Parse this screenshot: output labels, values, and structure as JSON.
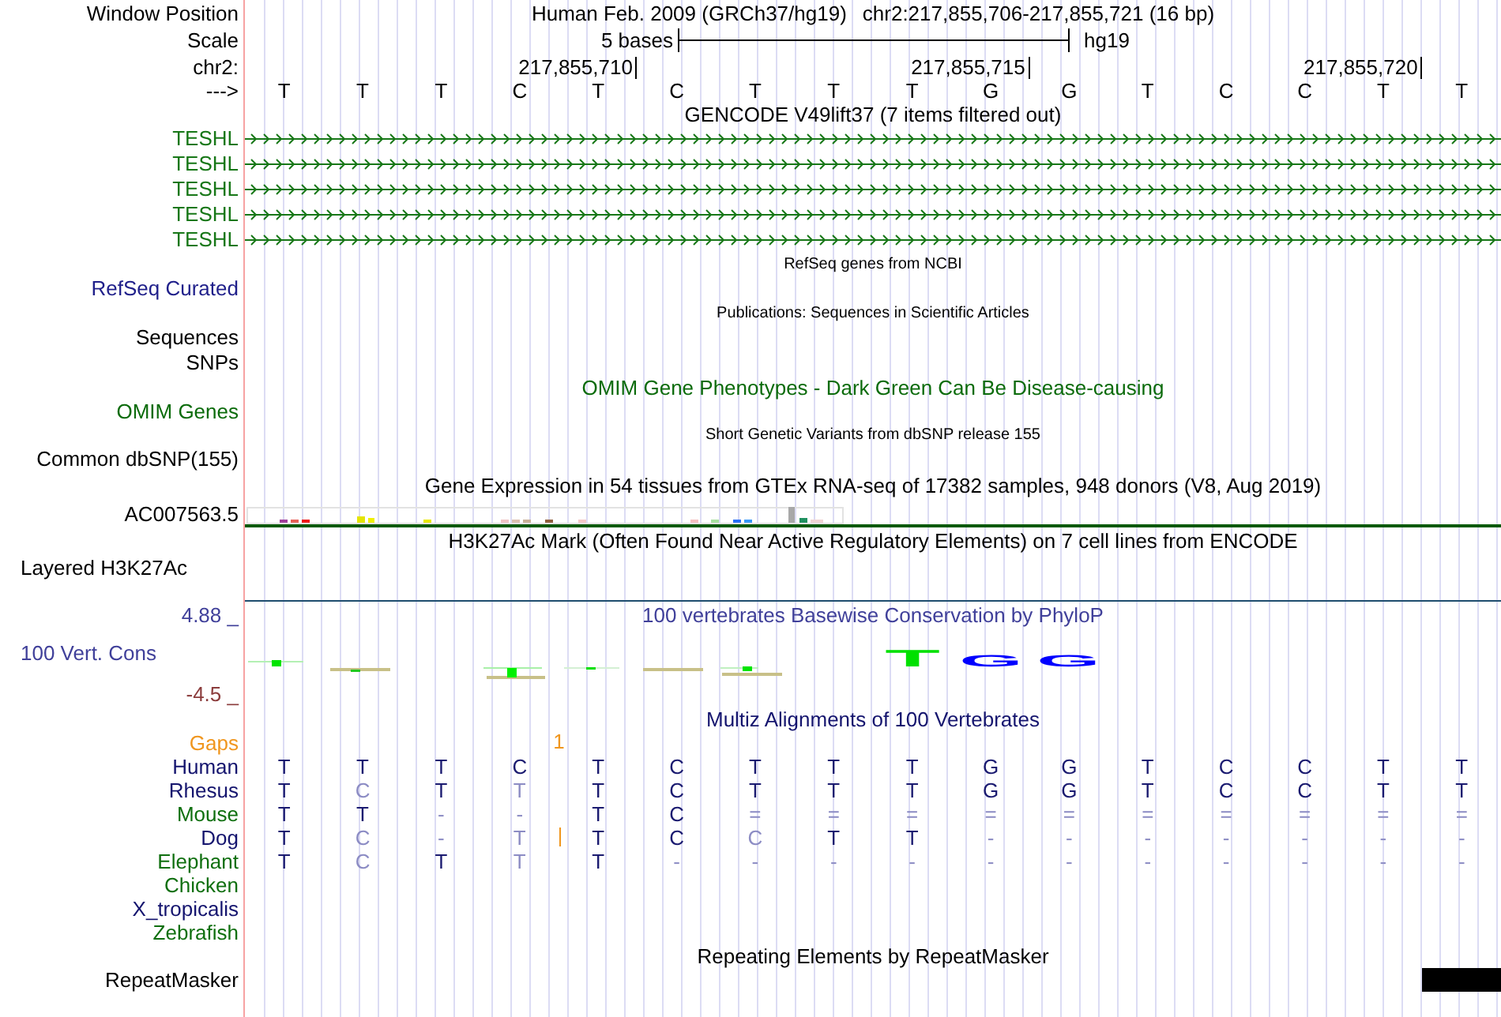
{
  "ruler": {
    "window_position": {
      "label": "Window Position",
      "genome": "Human Feb. 2009 (GRCh37/hg19)",
      "position": "chr2:217,855,706-217,855,721 (16 bp)"
    },
    "scale": {
      "label": "Scale",
      "length": "5 bases",
      "assembly": "hg19"
    },
    "coordinates": {
      "label": "chr2:",
      "ticks": [
        "217,855,710",
        "217,855,715",
        "217,855,720"
      ]
    },
    "bases": {
      "label": "--->",
      "sequence": [
        "T",
        "T",
        "T",
        "C",
        "T",
        "C",
        "T",
        "T",
        "T",
        "G",
        "G",
        "T",
        "C",
        "C",
        "T",
        "T"
      ]
    }
  },
  "tracks": [
    {
      "kind": "genes",
      "title": {
        "text": "GENCODE V49lift37 (7 items filtered out)",
        "color": "#000000"
      },
      "color": "#177717",
      "labels": [
        "TESHL",
        "TESHL",
        "TESHL",
        "TESHL",
        "TESHL"
      ]
    },
    {
      "kind": "composite",
      "title": {
        "text": "RefSeq genes from NCBI",
        "color": "#000000"
      },
      "color": "#1f1f8a",
      "labels": [
        "RefSeq Curated"
      ]
    },
    {
      "kind": "composite",
      "title": {
        "text": "Publications: Sequences in Scientific Articles",
        "color": "#000000"
      },
      "color": "#000000",
      "labels": [
        "Sequences",
        "SNPs"
      ]
    },
    {
      "kind": "track",
      "title": {
        "text": "OMIM Gene Phenotypes - Dark Green Can Be Disease-causing",
        "color": "#0b6b0b"
      },
      "color": "#0b6b0b",
      "labels": [
        "OMIM Genes"
      ]
    },
    {
      "kind": "composite",
      "title": {
        "text": "Short Genetic Variants from dbSNP release 155",
        "color": "#000000"
      },
      "color": "#000000",
      "labels": [
        "Common dbSNP(155)"
      ]
    },
    {
      "kind": "expression",
      "title": {
        "text": "Gene Expression in 54 tissues from GTEx RNA-seq of 17382 samples, 948 donors (V8, Aug 2019)",
        "color": "#000000"
      },
      "color": "#000000",
      "labels": [
        "AC007563.5"
      ]
    },
    {
      "kind": "signal",
      "title": {
        "text": "H3K27Ac Mark (Often Found Near Active Regulatory Elements) on 7 cell lines from ENCODE",
        "color": "#000000"
      },
      "color": "#000000",
      "labels": [
        "Layered H3K27Ac"
      ]
    },
    {
      "kind": "conservation",
      "title": {
        "text": "100 vertebrates Basewise Conservation by PhyloP",
        "color": "#40409a"
      },
      "color": "#40409a",
      "labels": [
        "100 Vert. Cons"
      ],
      "max": "4.88 _",
      "min": {
        "text": "-4.5 _",
        "color": "#8b3c3c"
      },
      "logo": [
        {
          "base": "T",
          "color": "#00e000"
        },
        {
          "base": "G",
          "color": "#0000ff"
        },
        {
          "base": "G",
          "color": "#0000ff"
        }
      ]
    },
    {
      "kind": "alignment",
      "title": {
        "text": "Multiz Alignments of 100 Vertebrates",
        "color": "#14146e"
      },
      "gaps": {
        "label": "Gaps",
        "count": "1",
        "color": "#f0961e"
      },
      "species": [
        {
          "name": "Human",
          "color": "#14146e",
          "bases": [
            {
              "base": "T",
              "faded": false
            },
            {
              "base": "T",
              "faded": false
            },
            {
              "base": "T",
              "faded": false
            },
            {
              "base": "C",
              "faded": false
            },
            {
              "base": "T",
              "faded": false
            },
            {
              "base": "C",
              "faded": false
            },
            {
              "base": "T",
              "faded": false
            },
            {
              "base": "T",
              "faded": false
            },
            {
              "base": "T",
              "faded": false
            },
            {
              "base": "G",
              "faded": false
            },
            {
              "base": "G",
              "faded": false
            },
            {
              "base": "T",
              "faded": false
            },
            {
              "base": "C",
              "faded": false
            },
            {
              "base": "C",
              "faded": false
            },
            {
              "base": "T",
              "faded": false
            },
            {
              "base": "T",
              "faded": false
            }
          ]
        },
        {
          "name": "Rhesus",
          "color": "#14146e",
          "bases": [
            {
              "base": "T",
              "faded": false
            },
            {
              "base": "C",
              "faded": true
            },
            {
              "base": "T",
              "faded": false
            },
            {
              "base": "T",
              "faded": true
            },
            {
              "base": "T",
              "faded": false
            },
            {
              "base": "C",
              "faded": false
            },
            {
              "base": "T",
              "faded": false
            },
            {
              "base": "T",
              "faded": false
            },
            {
              "base": "T",
              "faded": false
            },
            {
              "base": "G",
              "faded": false
            },
            {
              "base": "G",
              "faded": false
            },
            {
              "base": "T",
              "faded": false
            },
            {
              "base": "C",
              "faded": false
            },
            {
              "base": "C",
              "faded": false
            },
            {
              "base": "T",
              "faded": false
            },
            {
              "base": "T",
              "faded": false
            }
          ]
        },
        {
          "name": "Mouse",
          "color": "#0f6f0f",
          "bases": [
            {
              "base": "T",
              "faded": false
            },
            {
              "base": "T",
              "faded": false
            },
            {
              "base": "-",
              "faded": true
            },
            {
              "base": "-",
              "faded": true
            },
            {
              "base": "T",
              "faded": false
            },
            {
              "base": "C",
              "faded": false
            },
            {
              "base": "=",
              "faded": true
            },
            {
              "base": "=",
              "faded": true
            },
            {
              "base": "=",
              "faded": true
            },
            {
              "base": "=",
              "faded": true
            },
            {
              "base": "=",
              "faded": true
            },
            {
              "base": "=",
              "faded": true
            },
            {
              "base": "=",
              "faded": true
            },
            {
              "base": "=",
              "faded": true
            },
            {
              "base": "=",
              "faded": true
            },
            {
              "base": "=",
              "faded": true
            }
          ]
        },
        {
          "name": "Dog",
          "color": "#14146e",
          "bases": [
            {
              "base": "T",
              "faded": false
            },
            {
              "base": "C",
              "faded": true
            },
            {
              "base": "-",
              "faded": true
            },
            {
              "base": "T",
              "faded": true,
              "insertion_after": true
            },
            {
              "base": "T",
              "faded": false
            },
            {
              "base": "C",
              "faded": false
            },
            {
              "base": "C",
              "faded": true
            },
            {
              "base": "T",
              "faded": false
            },
            {
              "base": "T",
              "faded": false
            },
            {
              "base": "-",
              "faded": true
            },
            {
              "base": "-",
              "faded": true
            },
            {
              "base": "-",
              "faded": true
            },
            {
              "base": "-",
              "faded": true
            },
            {
              "base": "-",
              "faded": true
            },
            {
              "base": "-",
              "faded": true
            },
            {
              "base": "-",
              "faded": true
            }
          ]
        },
        {
          "name": "Elephant",
          "color": "#0f6f0f",
          "bases": [
            {
              "base": "T",
              "faded": false
            },
            {
              "base": "C",
              "faded": true
            },
            {
              "base": "T",
              "faded": false
            },
            {
              "base": "T",
              "faded": true
            },
            {
              "base": "T",
              "faded": false
            },
            {
              "base": "-",
              "faded": true
            },
            {
              "base": "-",
              "faded": true
            },
            {
              "base": "-",
              "faded": true
            },
            {
              "base": "-",
              "faded": true
            },
            {
              "base": "-",
              "faded": true
            },
            {
              "base": "-",
              "faded": true
            },
            {
              "base": "-",
              "faded": true
            },
            {
              "base": "-",
              "faded": true
            },
            {
              "base": "-",
              "faded": true
            },
            {
              "base": "-",
              "faded": true
            },
            {
              "base": "-",
              "faded": true
            }
          ]
        },
        {
          "name": "Chicken",
          "color": "#0f6f0f"
        },
        {
          "name": "X_tropicalis",
          "color": "#14146e"
        },
        {
          "name": "Zebrafish",
          "color": "#0f6f0f"
        }
      ]
    },
    {
      "kind": "repeats",
      "title": {
        "text": "Repeating Elements by RepeatMasker",
        "color": "#000000"
      },
      "color": "#000000",
      "labels": [
        "RepeatMasker"
      ]
    }
  ]
}
